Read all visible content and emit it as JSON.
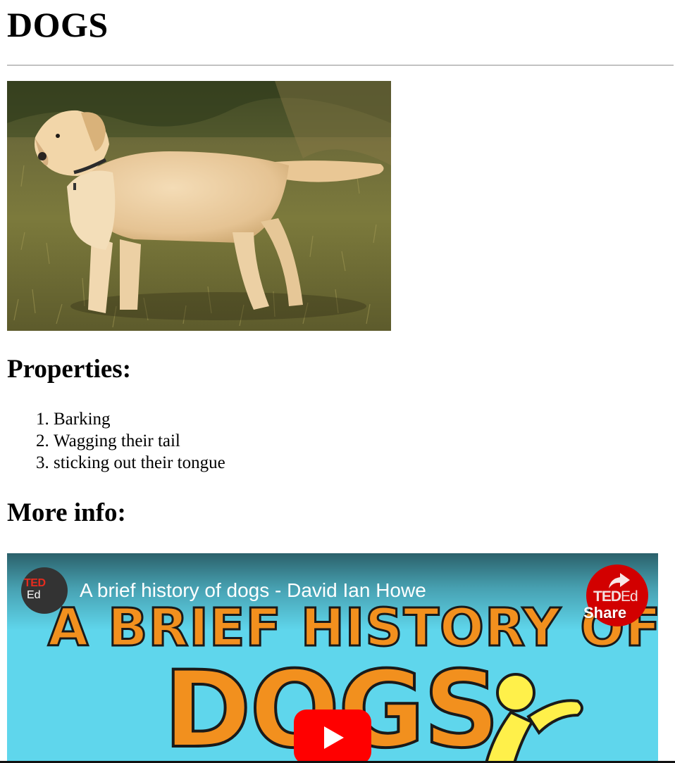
{
  "page": {
    "title": "DOGS",
    "image_alt": "Yellow Labrador dog standing on grass",
    "properties_heading": "Properties:",
    "properties": [
      "Barking",
      "Wagging their tail",
      "sticking out their tongue"
    ],
    "more_info_heading": "More info:"
  },
  "video": {
    "channel": {
      "ted": "TED",
      "ed": "Ed"
    },
    "title": "A brief history of dogs - David Ian Howe",
    "share": {
      "ted": "TED",
      "ed": "Ed",
      "label": "Share"
    },
    "thumbnail_line1": "A BRIEF HISTORY OF",
    "thumbnail_line2": "DOGS",
    "colors": {
      "sky": "#5fd6ec",
      "headline_fill": "#f2901e",
      "share_red": "#d20000",
      "play_red": "#ff0000",
      "figure_yellow": "#fff04a"
    }
  }
}
